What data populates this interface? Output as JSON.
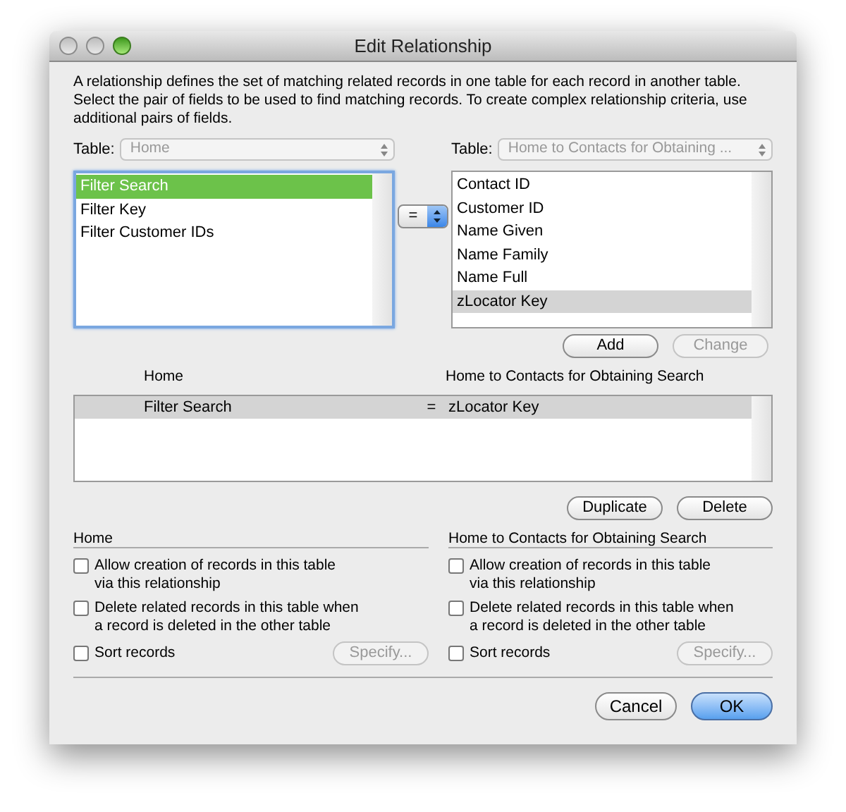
{
  "window": {
    "title": "Edit Relationship"
  },
  "description": "A relationship defines the set of matching related records in one table for each record in another table. Select the pair of fields to be used to find matching records. To create complex relationship criteria, use additional pairs of fields.",
  "left_table": {
    "label": "Table:",
    "value": "Home",
    "disabled": true,
    "focused": true,
    "fields": [
      {
        "name": "Filter Search",
        "selected": true
      },
      {
        "name": "Filter Key",
        "selected": false
      },
      {
        "name": "Filter Customer IDs",
        "selected": false
      }
    ]
  },
  "operator": {
    "value": "="
  },
  "right_table": {
    "label": "Table:",
    "value": "Home to Contacts for Obtaining ...",
    "disabled": true,
    "focused": false,
    "fields": [
      {
        "name": "Contact ID",
        "selected": false
      },
      {
        "name": "Customer ID",
        "selected": false
      },
      {
        "name": "Name Given",
        "selected": false
      },
      {
        "name": "Name Family",
        "selected": false
      },
      {
        "name": "Name Full",
        "selected": false
      },
      {
        "name": "zLocator Key",
        "selected": true
      }
    ]
  },
  "pair_buttons": [
    {
      "label": "Add",
      "disabled": false
    },
    {
      "label": "Change",
      "disabled": true
    }
  ],
  "criteria": {
    "columns": [
      "Home",
      "Home to Contacts for Obtaining Search"
    ],
    "rows": [
      {
        "left": "Filter Search",
        "operator": "=",
        "right": "zLocator Key",
        "selected": true
      }
    ]
  },
  "criteria_buttons": [
    {
      "label": "Duplicate",
      "disabled": false
    },
    {
      "label": "Delete",
      "disabled": false
    }
  ],
  "options": [
    {
      "heading": "Home",
      "checkboxes": [
        {
          "label": "Allow creation of records in this table\nvia this relationship",
          "checked": false
        },
        {
          "label": "Delete related records in this table when\na record is deleted in the other table",
          "checked": false
        },
        {
          "label": "Sort records",
          "checked": false
        }
      ],
      "specify": {
        "label": "Specify...",
        "disabled": true
      }
    },
    {
      "heading": "Home to Contacts for Obtaining Search",
      "checkboxes": [
        {
          "label": "Allow creation of records in this table\nvia this relationship",
          "checked": false
        },
        {
          "label": "Delete related records in this table when\na record is deleted in the other table",
          "checked": false
        },
        {
          "label": "Sort records",
          "checked": false
        }
      ],
      "specify": {
        "label": "Specify...",
        "disabled": true
      }
    }
  ],
  "dialog_buttons": [
    {
      "label": "Cancel",
      "default": false
    },
    {
      "label": "OK",
      "default": true
    }
  ]
}
